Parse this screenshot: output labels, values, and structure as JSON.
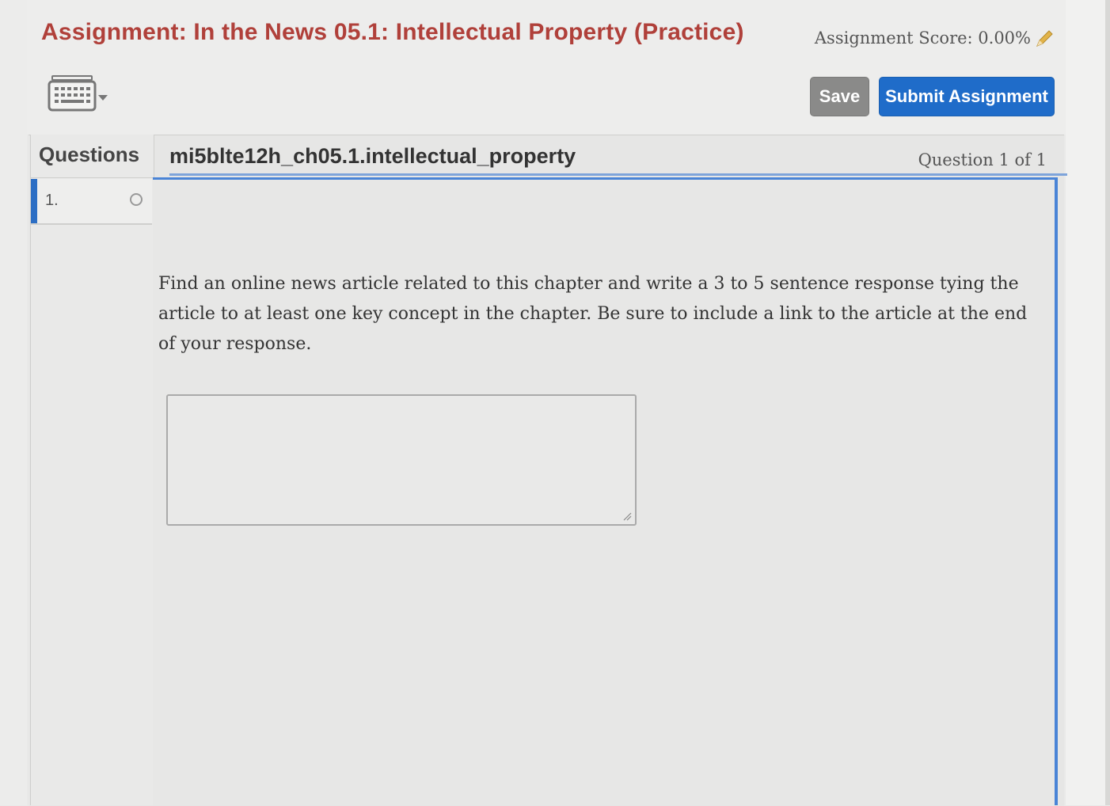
{
  "header": {
    "title": "Assignment: In the News 05.1: Intellectual Property (Practice)",
    "score_text": "Assignment Score: 0.00%",
    "save_label": "Save",
    "submit_label": "Submit Assignment"
  },
  "sidebar": {
    "heading": "Questions",
    "items": [
      {
        "label": "1."
      }
    ]
  },
  "question": {
    "id": "mi5blte12h_ch05.1.intellectual_property",
    "counter": "Question 1 of 1",
    "prompt": "Find an online news article related to this chapter and write a 3 to 5 sentence response tying the article to at least one key concept in the chapter. Be sure to include a link to the article at the end of your response.",
    "response_value": ""
  },
  "colors": {
    "title": "#b0403a",
    "submit_bg": "#1f6cc9",
    "save_bg": "#8a8a89",
    "accent_border": "#4a84d6"
  }
}
